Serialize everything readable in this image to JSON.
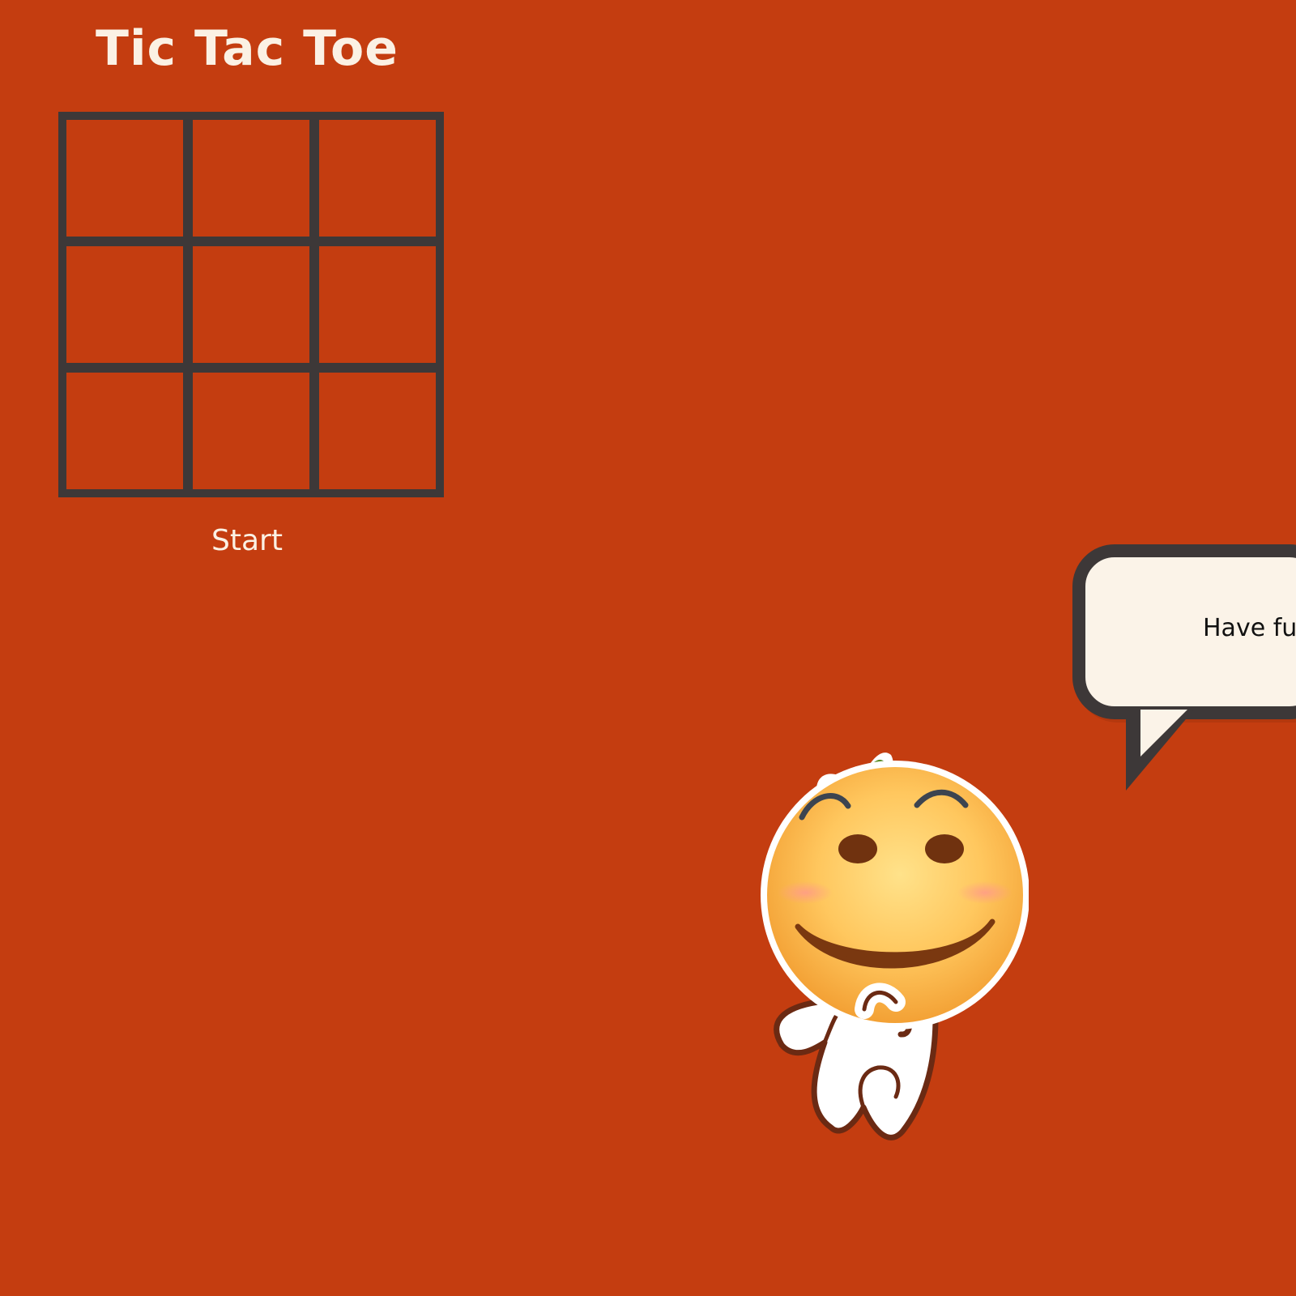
{
  "title": "Tic Tac Toe",
  "board": {
    "cells": [
      "",
      "",
      "",
      "",
      "",
      "",
      "",
      "",
      ""
    ]
  },
  "start_label": "Start",
  "speech_bubble": {
    "text": "Have fun."
  },
  "mascot": {
    "icon": "orange-mascot-icon"
  },
  "colors": {
    "background": "#c43d10",
    "board_lines": "#3d3838",
    "title_text": "#fbf1e4",
    "bubble_fill": "#fbf3e8",
    "bubble_border": "#3d3838"
  }
}
